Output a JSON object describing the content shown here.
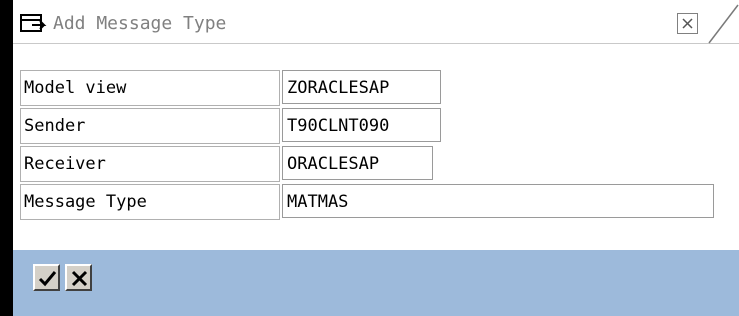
{
  "dialog": {
    "title": "Add Message Type"
  },
  "fields": [
    {
      "label": "Model view",
      "value": "ZORACLESAP"
    },
    {
      "label": "Sender",
      "value": "T90CLNT090"
    },
    {
      "label": "Receiver",
      "value": "ORACLESAP"
    },
    {
      "label": "Message Type",
      "value": "MATMAS"
    }
  ],
  "toolbar": {
    "confirm_icon": "checkmark-icon",
    "cancel_icon": "cross-icon"
  },
  "colors": {
    "footer_bg": "#9dbadb",
    "button_face": "#d4d0c8"
  }
}
